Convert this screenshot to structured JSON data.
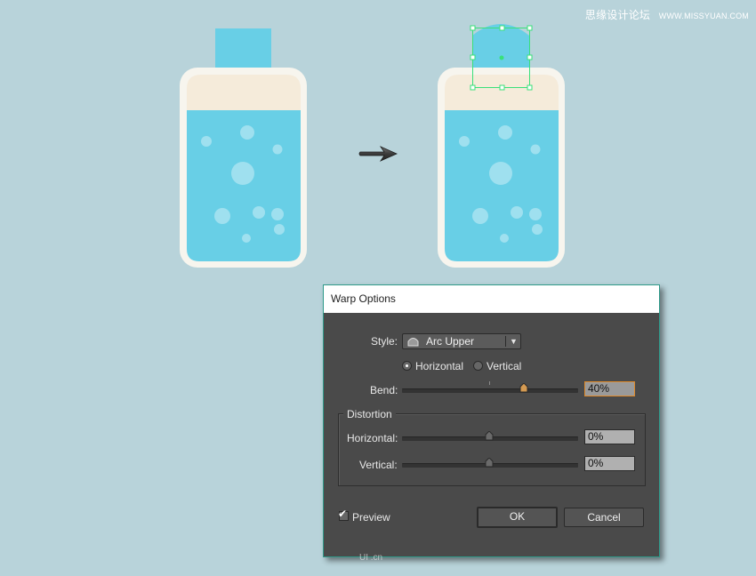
{
  "watermark": {
    "site_cn": "思缘设计论坛",
    "site_url": "WWW.MISSYUAN.COM"
  },
  "dialog": {
    "title": "Warp Options",
    "style_label": "Style:",
    "style_value": "Arc Upper",
    "orientation": {
      "horizontal_label": "Horizontal",
      "vertical_label": "Vertical",
      "selected": "Horizontal"
    },
    "bend": {
      "label": "Bend:",
      "value": "40%",
      "percent": 40
    },
    "distortion": {
      "title": "Distortion",
      "horizontal": {
        "label": "Horizontal:",
        "value": "0%",
        "percent": 0
      },
      "vertical": {
        "label": "Vertical:",
        "value": "0%",
        "percent": 0
      }
    },
    "preview": {
      "label": "Preview",
      "checked": true
    },
    "ok_label": "OK",
    "cancel_label": "Cancel"
  },
  "colors": {
    "background": "#b8d3da",
    "bottle_outer": "#f7f5ee",
    "bottle_top": "#f5ebda",
    "liquid": "#68cfe6",
    "bubble": "#9fe0ef",
    "selection": "#39e07a"
  },
  "footer_mark": "UI .cn"
}
